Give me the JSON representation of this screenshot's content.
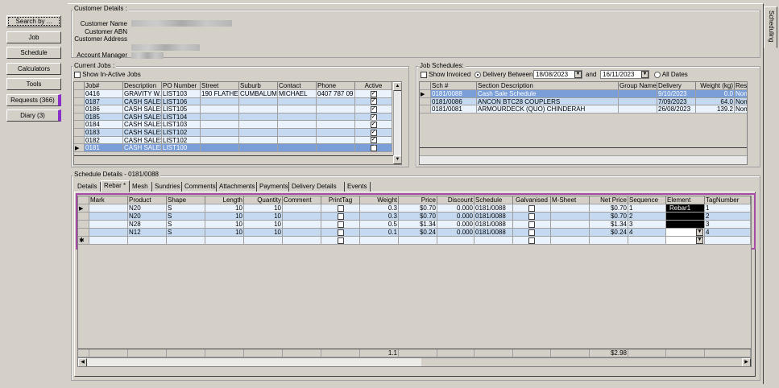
{
  "nav": {
    "buttons": [
      {
        "label": "Search by ...",
        "flag": false
      },
      {
        "label": "Job",
        "flag": false
      },
      {
        "label": "Schedule",
        "flag": false
      },
      {
        "label": "Calculators",
        "flag": false
      },
      {
        "label": "Tools",
        "flag": false
      },
      {
        "label": "Requests (366)",
        "flag": true
      },
      {
        "label": "Diary (3)",
        "flag": true
      }
    ],
    "flag_color": "#8b2fc9"
  },
  "side_tab": "Scheduling",
  "customer": {
    "legend": "Customer Details :",
    "name_label": "Customer Name",
    "abn_label": "Customer ABN",
    "address_label": "Customer Address",
    "manager_label": "Account Manager"
  },
  "jobs": {
    "legend": "Current Jobs :",
    "show_inactive": "Show In-Active Jobs",
    "columns": [
      "Job#",
      "Description",
      "PO Number",
      "Street",
      "Suburb",
      "Contact",
      "Phone",
      "Active"
    ],
    "rows": [
      [
        "0416",
        "GRAVITY W.",
        "LIST103",
        "190 FLATHE",
        "CUMBALUM",
        "MICHAEL",
        "0407 787 09",
        true
      ],
      [
        "0187",
        "CASH SALES",
        "LIST106",
        "",
        "",
        "",
        "",
        true
      ],
      [
        "0186",
        "CASH SALES",
        "LIST105",
        "",
        "",
        "",
        "",
        true
      ],
      [
        "0185",
        "CASH SALES",
        "LIST104",
        "",
        "",
        "",
        "",
        true
      ],
      [
        "0184",
        "CASH SALES",
        "LIST103",
        "",
        "",
        "",
        "",
        true
      ],
      [
        "0183",
        "CASH SALES",
        "LIST102",
        "",
        "",
        "",
        "",
        true
      ],
      [
        "0182",
        "CASH SALES",
        "LIST102",
        "",
        "",
        "",
        "",
        true
      ],
      [
        "0181",
        "CASH SALES",
        "LIST100",
        "",
        "",
        "",
        "",
        true
      ]
    ],
    "selected": 7
  },
  "schedules": {
    "legend": "Job Schedules:",
    "show_invoiced": "Show Invoiced",
    "delivery_between": "Delivery Between",
    "from": "18/08/2023",
    "and": "and",
    "to": "16/11/2023",
    "all_dates": "All Dates",
    "columns": [
      "Sch #",
      "Section Description",
      "Group Name",
      "Delivery",
      "Weight (kg)",
      "Res"
    ],
    "rows": [
      [
        "0181/0088",
        "Cash Sale Schedule",
        "",
        "9/10/2023",
        "0.0",
        "Non"
      ],
      [
        "0181/0086",
        "ANCON BTC28 COUPLERS",
        "",
        "7/09/2023",
        "64.0",
        "Non"
      ],
      [
        "0181/0081",
        "ARMOURDECK (QUO) CHINDERAH",
        "",
        "26/08/2023",
        "139.2",
        "Non"
      ]
    ],
    "selected": 0
  },
  "details": {
    "legend": "Schedule Details - 0181/0088",
    "tabs": [
      "Details",
      "Rebar *",
      "Mesh",
      "Sundries",
      "Comments",
      "Attachments",
      "Payments",
      "Delivery Details",
      "Events"
    ],
    "active_tab": 1,
    "highlight_color": "#a64ca6",
    "columns": [
      "Mark",
      "Product",
      "Shape",
      "Length",
      "Quantity",
      "Comment",
      "PrintTag",
      "Weight",
      "Price",
      "Discount",
      "Schedule",
      "Galvanised",
      "M-Sheet",
      "Net Price",
      "Sequence",
      "Element",
      "TagNumber"
    ],
    "rows": [
      [
        "",
        "N20",
        "S",
        "10",
        "10",
        "",
        false,
        "0.3",
        "$0.70",
        "0.000",
        "0181/0088",
        false,
        "",
        "$0.70",
        "1",
        "Rebar1",
        "1"
      ],
      [
        "",
        "N20",
        "S",
        "10",
        "10",
        "",
        false,
        "0.3",
        "$0.70",
        "0.000",
        "0181/0088",
        false,
        "",
        "$0.70",
        "2",
        "",
        "2"
      ],
      [
        "",
        "N28",
        "S",
        "10",
        "10",
        "",
        false,
        "0.5",
        "$1.34",
        "0.000",
        "0181/0088",
        false,
        "",
        "$1.34",
        "3",
        "",
        "3"
      ],
      [
        "",
        "N12",
        "S",
        "10",
        "10",
        "",
        false,
        "0.1",
        "$0.24",
        "0.000",
        "0181/0088",
        false,
        "",
        "$0.24",
        "4",
        "",
        "4"
      ]
    ],
    "totals": {
      "weight": "1.1",
      "net_price": "$2.98"
    }
  }
}
